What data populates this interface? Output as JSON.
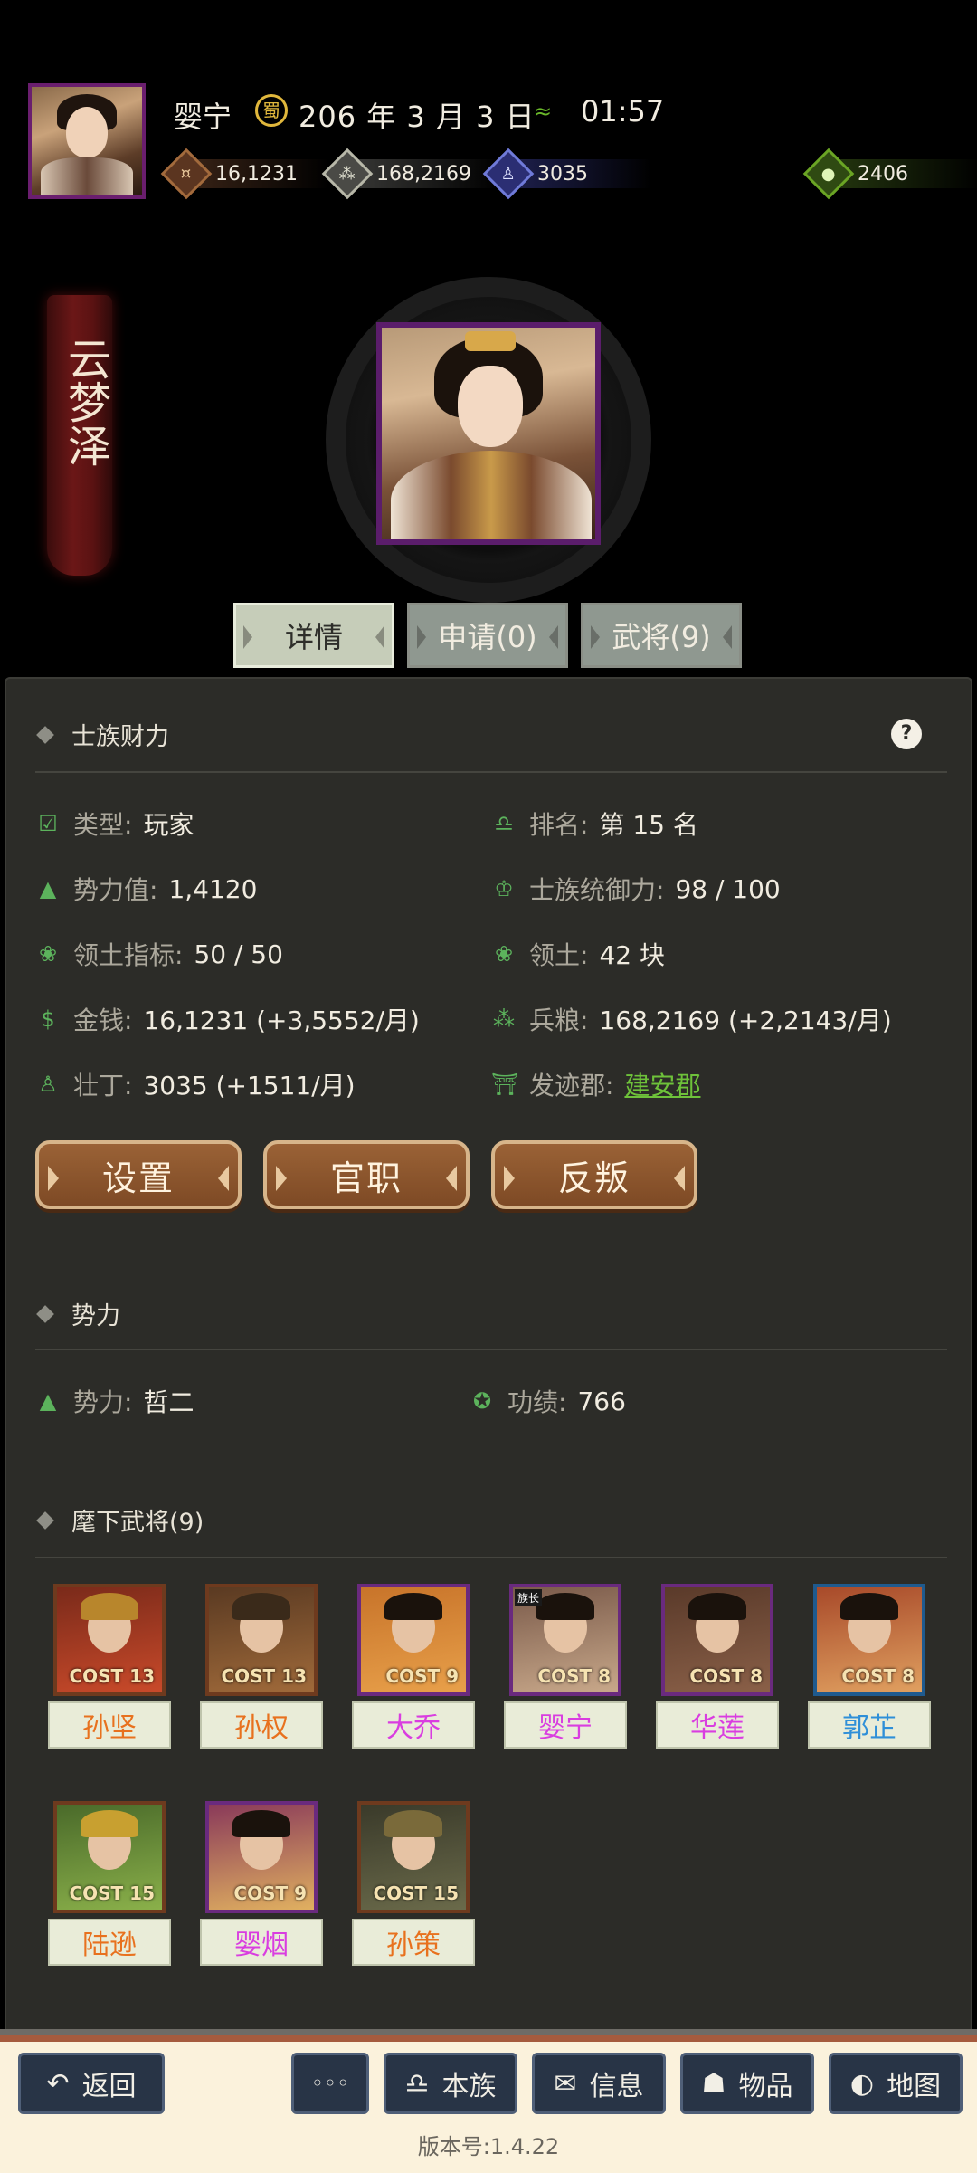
{
  "header": {
    "player_name": "婴宁",
    "date_icon": "蜀",
    "date": "206 年 3 月 3 日",
    "time_icon": "grasshopper-icon",
    "time": "01:57",
    "resources": {
      "money": "16,1231",
      "grain": "168,2169",
      "manpower": "3035",
      "gold": "2406"
    }
  },
  "clan_banner": "云梦泽",
  "tabs": [
    "详情",
    "申请(0)",
    "武将(9)"
  ],
  "wealth": {
    "title": "士族财力",
    "help": "?",
    "type_label": "类型:",
    "type_value": "玩家",
    "rank_label": "排名:",
    "rank_value": "第 15 名",
    "power_label": "势力值:",
    "power_value": "1,4120",
    "control_label": "士族统御力:",
    "control_value": "98 / 100",
    "territory_quota_label": "领土指标:",
    "territory_quota_value": "50 / 50",
    "territory_label": "领土:",
    "territory_value": "42 块",
    "money_label": "金钱:",
    "money_value": "16,1231 (+3,5552/月)",
    "grain_label": "兵粮:",
    "grain_value": "168,2169 (+2,2143/月)",
    "men_label": "壮丁:",
    "men_value": "3035 (+1511/月)",
    "origin_label": "发迹郡:",
    "origin_value": "建安郡"
  },
  "actions": [
    "设置",
    "官职",
    "反叛"
  ],
  "faction": {
    "title": "势力",
    "faction_label": "势力:",
    "faction_value": "哲二",
    "merit_label": "功绩:",
    "merit_value": "766"
  },
  "generals": {
    "title": "麾下武将(9)",
    "list": [
      {
        "name": "孙坚",
        "cost": "COST 13",
        "color": "#e8711e",
        "border": "#6e3a1e",
        "tag": ""
      },
      {
        "name": "孙权",
        "cost": "COST 13",
        "color": "#e8711e",
        "border": "#6e3a1e",
        "tag": ""
      },
      {
        "name": "大乔",
        "cost": "COST 9",
        "color": "#d93de0",
        "border": "#6a2a7e",
        "tag": ""
      },
      {
        "name": "婴宁",
        "cost": "COST 8",
        "color": "#d93de0",
        "border": "#6a2a7e",
        "tag": "族长"
      },
      {
        "name": "华莲",
        "cost": "COST 8",
        "color": "#d93de0",
        "border": "#6a2a7e",
        "tag": ""
      },
      {
        "name": "郭芷",
        "cost": "COST 8",
        "color": "#2f8fd8",
        "border": "#1f5a8e",
        "tag": ""
      },
      {
        "name": "陆逊",
        "cost": "COST 15",
        "color": "#e8711e",
        "border": "#6e3a1e",
        "tag": ""
      },
      {
        "name": "婴烟",
        "cost": "COST 9",
        "color": "#d93de0",
        "border": "#6a2a7e",
        "tag": ""
      },
      {
        "name": "孙策",
        "cost": "COST 15",
        "color": "#e8711e",
        "border": "#6e3a1e",
        "tag": ""
      }
    ]
  },
  "bottom_nav": {
    "back": "返回",
    "more": "◦◦◦",
    "clan": "本族",
    "info": "信息",
    "items": "物品",
    "map": "地图"
  },
  "version": "版本号:1.4.22"
}
